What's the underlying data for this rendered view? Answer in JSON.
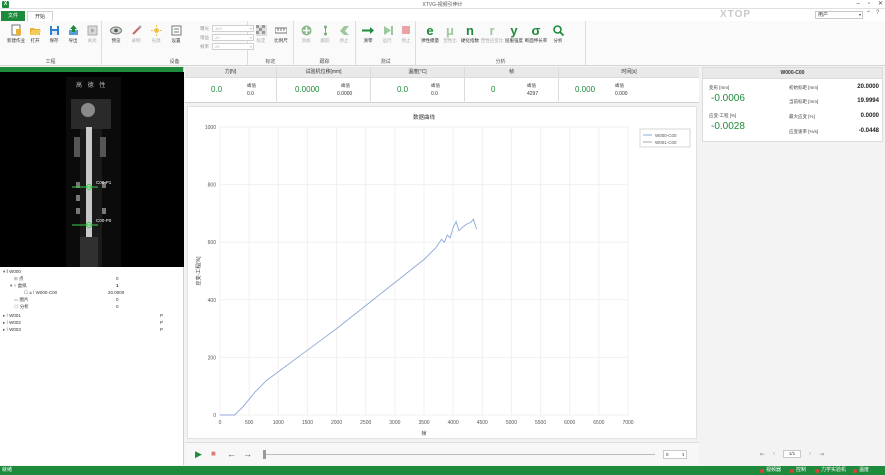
{
  "window": {
    "title": "XTVG-视频引伸计"
  },
  "tabs": {
    "file": "文件",
    "start": "开始"
  },
  "brand": "XTOP",
  "user": {
    "value": "用户"
  },
  "ribbon": {
    "groups": {
      "project": "工程",
      "device": "设备",
      "calibration": "标定",
      "track": "跟踪",
      "test": "测试",
      "analysis": "分析"
    },
    "buttons": {
      "new_project": "新建作业",
      "open": "打开",
      "save": "保存",
      "export": "导出",
      "close": "关闭",
      "preview": "预览",
      "record": "录制",
      "light": "光源",
      "settings": "设置",
      "calib": "标定",
      "ratio": "比例尺",
      "add_mark": "添加",
      "track": "跟踪",
      "stop_track": "停止",
      "clear": "清零",
      "run": "运行",
      "stop": "停止",
      "elastic_modulus": "弹性模量",
      "plastic_ratio": "塑性比",
      "strain_hardening": "硬化指数",
      "plastic_strain_ratio": "塑性应变比",
      "yield_strength": "屈服强度",
      "tensile_strength": "断面伸长率",
      "analyze": "分析"
    },
    "device_settings": [
      {
        "label": "曝光",
        "value": "300"
      },
      {
        "label": "增益",
        "value": "20"
      },
      {
        "label": "帧率",
        "value": "25"
      }
    ]
  },
  "readouts": [
    {
      "title": "力[N]",
      "value": "0.0",
      "peak_label": "峰值",
      "peak_value": "0.0"
    },
    {
      "title": "试验机位移[mm]",
      "value": "0.0000",
      "peak_label": "峰值",
      "peak_value": "0.0000"
    },
    {
      "title": "温度[°C]",
      "value": "0.0",
      "peak_label": "峰值",
      "peak_value": "0.0"
    },
    {
      "title": "帧",
      "value": "0",
      "peak_label": "峰值",
      "peak_value": "4297"
    },
    {
      "title": "时间[s]",
      "value": "0.000",
      "peak_label": "峰值",
      "peak_value": "0.000"
    }
  ],
  "image_panel": {
    "header_chars": "高 德 性",
    "marker1": "C00-P1",
    "marker2": "C00-P0"
  },
  "tree": [
    {
      "label": "W000",
      "value": "",
      "flag": ""
    },
    {
      "label": "点",
      "value": "0",
      "flag": ""
    },
    {
      "label": "虚拟",
      "value": "1",
      "flag": ""
    },
    {
      "label": "W000-C00",
      "value": "20.0000",
      "flag": ""
    },
    {
      "label": "图片",
      "value": "0",
      "flag": ""
    },
    {
      "label": "分析",
      "value": "0",
      "flag": ""
    },
    {
      "label": "W001",
      "value": "",
      "flag": "P"
    },
    {
      "label": "W002",
      "value": "",
      "flag": "P"
    },
    {
      "label": "W003",
      "value": "",
      "flag": "P"
    }
  ],
  "playback": {
    "frame": "0"
  },
  "right_panel": {
    "title": "W000-C00",
    "deform_label": "变形 [mm]",
    "deform_value": "-0.0006",
    "strain_label": "应变-工程 [%]",
    "strain_value": "-0.0028",
    "rows": [
      {
        "label": "初始标距 [mm]",
        "value": "20.0000"
      },
      {
        "label": "当前标距 [mm]",
        "value": "19.9994"
      },
      {
        "label": "最大应变 [%]",
        "value": "0.0000"
      },
      {
        "label": "应变速率 [%/s]",
        "value": "-0.0448"
      }
    ],
    "pager": "1/1"
  },
  "statusbar": {
    "left": "就绪",
    "items": [
      "视频器",
      "控制",
      "力学实验机",
      "温度"
    ],
    "colors": {
      "status_dot": "#e23b3b"
    }
  },
  "colors": {
    "accent": "#1e8a3c",
    "series1": "#8fa8d8",
    "series2": "#a8a8a8"
  },
  "chart_data": {
    "type": "line",
    "title": "数据曲线",
    "xlabel": "帧",
    "ylabel": "应变-工程[%]",
    "xlim": [
      0,
      7000
    ],
    "ylim": [
      0,
      1000
    ],
    "xticks": [
      0,
      500,
      1000,
      1500,
      2000,
      2500,
      3000,
      3500,
      4000,
      4500,
      5000,
      5500,
      6000,
      6500,
      7000
    ],
    "yticks": [
      0,
      200,
      400,
      600,
      800,
      1000
    ],
    "legend_position": "top-right",
    "grid": true,
    "series": [
      {
        "name": "W000-C00",
        "x": [
          0,
          250,
          400,
          600,
          800,
          1000,
          1500,
          2000,
          2500,
          3000,
          3500,
          3700,
          3800,
          3850,
          3900,
          3950,
          4000,
          4050,
          4100,
          4150,
          4200,
          4250,
          4300,
          4350,
          4400
        ],
        "y": [
          0,
          0,
          30,
          80,
          120,
          150,
          225,
          300,
          380,
          460,
          540,
          580,
          610,
          600,
          625,
          615,
          650,
          672,
          640,
          650,
          658,
          665,
          668,
          680,
          645
        ]
      },
      {
        "name": "W001-C00",
        "x": [],
        "y": []
      }
    ]
  }
}
